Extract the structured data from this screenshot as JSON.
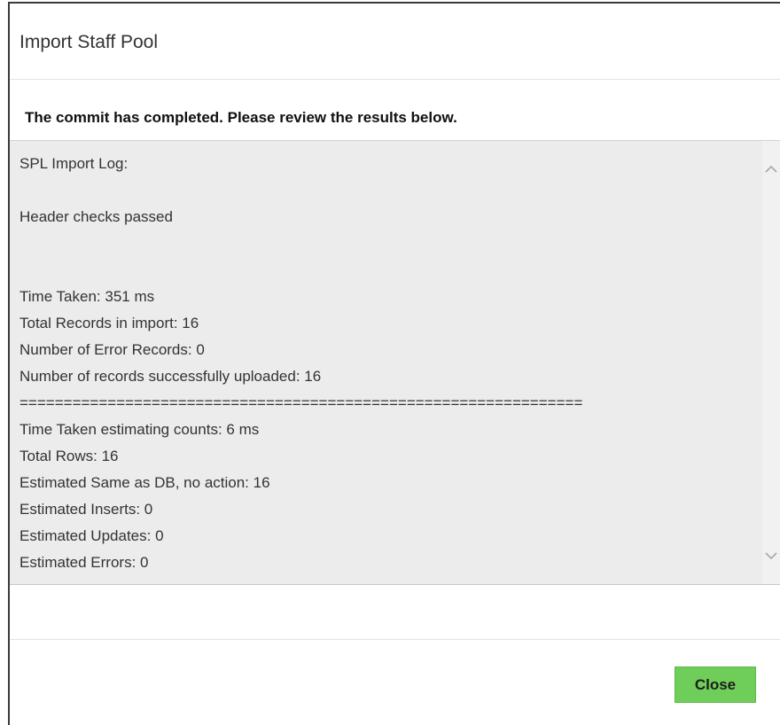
{
  "dialog": {
    "title": "Import Staff Pool",
    "status_message": "The commit has completed. Please review the results below.",
    "close_label": "Close"
  },
  "log": {
    "lines": [
      "SPL Import Log:",
      "",
      "Header checks passed",
      "",
      "",
      "Time Taken: 351 ms",
      "Total Records in import: 16",
      "Number of Error Records: 0",
      "Number of records successfully uploaded: 16",
      "================================================================",
      "Time Taken estimating counts: 6 ms",
      "Total Rows: 16",
      "Estimated Same as DB, no action: 16",
      "Estimated Inserts: 0",
      "Estimated Updates: 0",
      "Estimated Errors: 0"
    ]
  },
  "icons": {
    "scroll_up": "chevron-up-icon",
    "scroll_down": "chevron-down-icon"
  },
  "colors": {
    "close_button": "#6fce5a",
    "log_background": "#ececec"
  }
}
